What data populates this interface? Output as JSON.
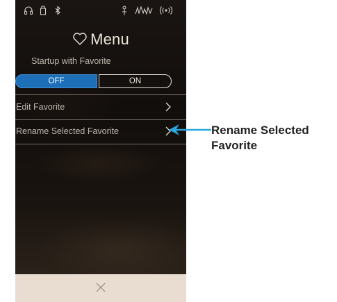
{
  "status_bar": {
    "left_icons": [
      "headphones-icon",
      "usb-icon",
      "bluetooth-icon"
    ],
    "right_icons": [
      "microphone-icon",
      "audio-level-icon",
      "wireless-icon"
    ]
  },
  "menu": {
    "title": "Menu",
    "title_icon": "heart-icon",
    "startup_label": "Startup with Favorite",
    "toggle": {
      "off_label": "OFF",
      "on_label": "ON",
      "selected": "OFF"
    },
    "items": [
      {
        "label": "Edit Favorite"
      },
      {
        "label": "Rename Selected Favorite"
      }
    ]
  },
  "close_bar": {
    "icon": "close-icon"
  },
  "callout": {
    "label": "Rename Selected Favorite",
    "color": "#29a8e0"
  },
  "colors": {
    "toggle_active": "#1d6fb8",
    "close_bar": "#e9ddd1"
  }
}
